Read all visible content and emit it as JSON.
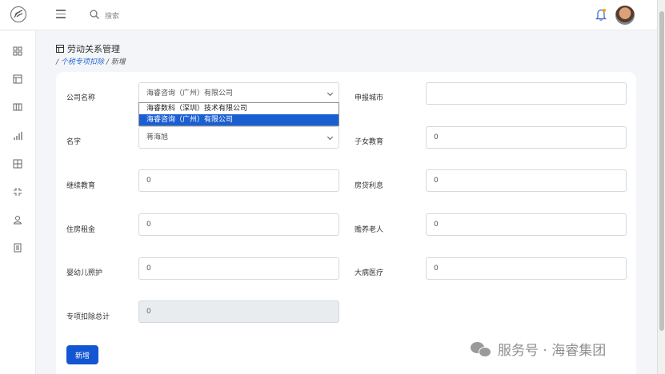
{
  "header": {
    "search_placeholder": "搜索"
  },
  "page": {
    "title": "劳动关系管理",
    "breadcrumb_sep": "/",
    "breadcrumb_link": "个税专项扣除",
    "breadcrumb_current": "新增"
  },
  "form": {
    "company_label": "公司名称",
    "company_value": "海睿咨询（广州）有限公司",
    "company_options": [
      "海睿数科（深圳）技术有限公司",
      "海睿咨询（广州）有限公司"
    ],
    "city_label": "申报城市",
    "city_value": "",
    "name_label": "名字",
    "name_value": "蒋海旭",
    "child_edu_label": "子女教育",
    "child_edu_value": "0",
    "cont_edu_label": "继续教育",
    "cont_edu_value": "0",
    "mortgage_label": "房贷利息",
    "mortgage_value": "0",
    "rent_label": "住房租金",
    "rent_value": "0",
    "elderly_label": "赡养老人",
    "elderly_value": "0",
    "infant_label": "婴幼儿照护",
    "infant_value": "0",
    "medical_label": "大病医疗",
    "medical_value": "0",
    "total_label": "专项扣除总计",
    "total_value": "0",
    "submit_label": "新增"
  },
  "watermark": {
    "text": "服务号 · 海睿集团"
  },
  "colors": {
    "primary": "#1456d2",
    "link": "#2a6bd1",
    "selected_option": "#1a5fd1"
  }
}
